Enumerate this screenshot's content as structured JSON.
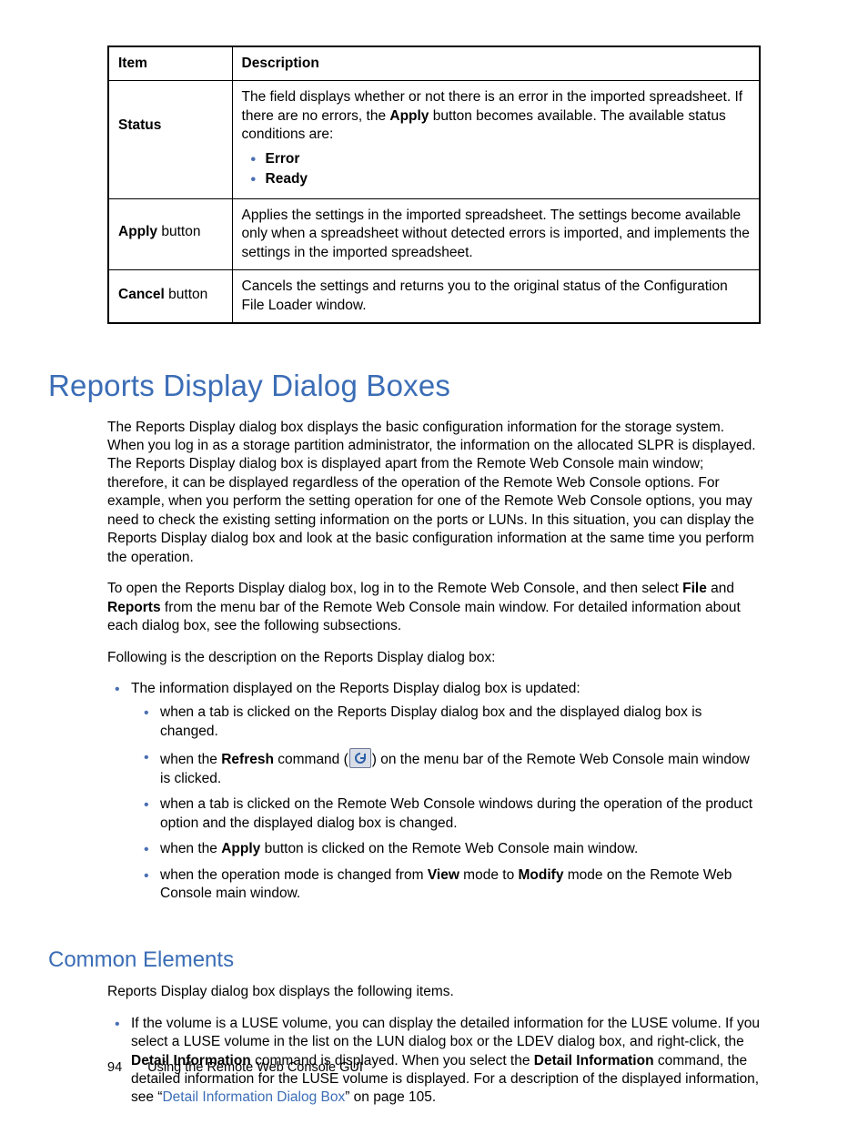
{
  "table": {
    "headers": {
      "item": "Item",
      "desc": "Description"
    },
    "rows": {
      "status": {
        "label": "Status",
        "desc_pre": "The field displays whether or not there is an error in the imported spreadsheet. If there are no errors, the ",
        "desc_bold1": "Apply",
        "desc_post": " button becomes available. The available status conditions are:",
        "bullets": [
          "Error",
          "Ready"
        ]
      },
      "apply": {
        "label_bold": "Apply",
        "label_rest": " button",
        "desc": "Applies the settings in the imported spreadsheet. The settings become available only when a spreadsheet without detected errors is imported, and implements the settings in the imported spreadsheet."
      },
      "cancel": {
        "label_bold": "Cancel",
        "label_rest": " button",
        "desc": "Cancels the settings and returns you to the original status of the Configuration File Loader window."
      }
    }
  },
  "h1": "Reports Display Dialog Boxes",
  "para1": "The Reports Display dialog box displays the basic configuration information for the storage system. When you log in as a storage partition administrator, the information on the allocated SLPR is displayed. The Reports Display dialog box is displayed apart from the Remote Web Console main window; therefore, it can be displayed regardless of the operation of the Remote Web Console options. For example, when you perform the setting operation for one of the Remote Web Console options, you may need to check the existing setting information on the ports or LUNs. In this situation, you can display the Reports Display dialog box and look at the basic configuration information at the same time you perform the operation.",
  "para2": {
    "pre": "To open the Reports Display dialog box, log in to the Remote Web Console, and then select ",
    "b1": "File",
    "mid1": " and ",
    "b2": "Reports",
    "post": " from the menu bar of the Remote Web Console main window. For detailed information about each dialog box, see the following subsections."
  },
  "para3": "Following is the description on the Reports Display dialog box:",
  "list1": {
    "lead": "The information displayed on the Reports Display dialog box is updated:",
    "items": {
      "a": "when a tab is clicked on the Reports Display dialog box and the displayed dialog box is changed.",
      "b_pre": "when the ",
      "b_b1": "Refresh",
      "b_mid": " command (",
      "b_post": ") on the menu bar of the Remote Web Console main window is clicked.",
      "c": "when a tab is clicked on the Remote Web Console windows during the operation of the product option and the displayed dialog box is changed.",
      "d_pre": "when the ",
      "d_b1": "Apply",
      "d_post": " button is clicked on the Remote Web Console main window.",
      "e_pre": "when the operation mode is changed from ",
      "e_b1": "View",
      "e_mid": " mode to ",
      "e_b2": "Modify",
      "e_post": " mode on the Remote Web Console main window."
    }
  },
  "h2": "Common Elements",
  "para4": "Reports Display dialog box displays the following items.",
  "list2": {
    "a_pre": "If the volume is a LUSE volume, you can display the detailed information for the LUSE volume. If you select a LUSE volume in the list on the LUN dialog box or the LDEV dialog box, and right-click, the ",
    "a_b1": "Detail Information",
    "a_mid1": " command is displayed. When you select the ",
    "a_b2": "Detail Information",
    "a_mid2": " command, the detailed information for the LUSE volume is displayed. For a description of the displayed information, see “",
    "a_link": "Detail Information Dialog Box",
    "a_post": "” on page 105."
  },
  "footer": {
    "page": "94",
    "title": "Using the Remote Web Console GUI"
  }
}
